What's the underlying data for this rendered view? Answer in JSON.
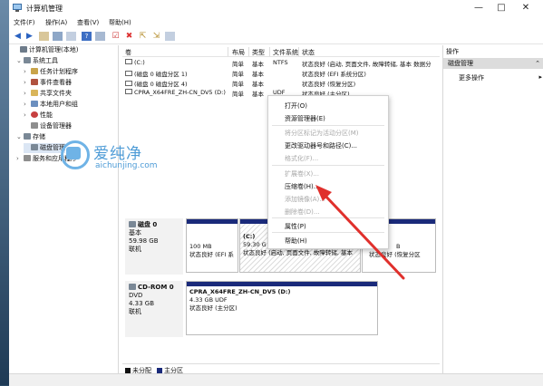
{
  "window": {
    "title": "计算机管理",
    "minimize": "—",
    "maximize": "□",
    "close": "✕"
  },
  "menu": [
    "文件(F)",
    "操作(A)",
    "查看(V)",
    "帮助(H)"
  ],
  "tree": [
    {
      "label": "计算机管理(本地)",
      "exp": "",
      "color": "#6d7b8a"
    },
    {
      "label": "系统工具",
      "exp": "⌄",
      "color": "#7a8896"
    },
    {
      "label": "任务计划程序",
      "exp": "›",
      "color": "#c9a44a"
    },
    {
      "label": "事件查看器",
      "exp": "›",
      "color": "#b0523f"
    },
    {
      "label": "共享文件夹",
      "exp": "›",
      "color": "#d9b55a"
    },
    {
      "label": "本地用户和组",
      "exp": "›",
      "color": "#6b8fbf"
    },
    {
      "label": "性能",
      "exp": "›",
      "color": "#c74040"
    },
    {
      "label": "设备管理器",
      "exp": "",
      "color": "#8e8e8e"
    },
    {
      "label": "存储",
      "exp": "⌄",
      "color": "#7a8896"
    },
    {
      "label": "磁盘管理",
      "exp": "",
      "color": "#7a8896"
    },
    {
      "label": "服务和应用程序",
      "exp": "›",
      "color": "#8e8e8e"
    }
  ],
  "volume_list": {
    "headers": [
      "卷",
      "布局",
      "类型",
      "文件系统",
      "状态"
    ],
    "rows": [
      {
        "name": "(C:)",
        "layout": "简单",
        "type": "基本",
        "fs": "NTFS",
        "status": "状态良好 (启动, 页面文件, 故障转储, 基本 数据分"
      },
      {
        "name": "(磁盘 0 磁盘分区 1)",
        "layout": "简单",
        "type": "基本",
        "fs": "",
        "status": "状态良好 (EFI 系统分区)"
      },
      {
        "name": "(磁盘 0 磁盘分区 4)",
        "layout": "简单",
        "type": "基本",
        "fs": "",
        "status": "状态良好 (恢复分区)"
      },
      {
        "name": "CPRA_X64FRE_ZH-CN_DV5 (D:)",
        "layout": "简单",
        "type": "基本",
        "fs": "UDF",
        "status": "状态良好 (主分区)"
      }
    ]
  },
  "context_menu": {
    "items": [
      {
        "label": "打开(O)",
        "disabled": false
      },
      {
        "label": "资源管理器(E)",
        "disabled": false
      },
      {
        "label": "将分区标记为活动分区(M)",
        "disabled": true
      },
      {
        "label": "更改驱动器号和路径(C)...",
        "disabled": false
      },
      {
        "label": "格式化(F)...",
        "disabled": true
      },
      {
        "label": "扩展卷(X)...",
        "disabled": true
      },
      {
        "label": "压缩卷(H)...",
        "disabled": false
      },
      {
        "label": "添加镜像(A)...",
        "disabled": true
      },
      {
        "label": "删除卷(D)...",
        "disabled": true
      },
      {
        "label": "属性(P)",
        "disabled": false
      },
      {
        "label": "帮助(H)",
        "disabled": false
      }
    ]
  },
  "actions": {
    "header": "操作",
    "selected": "磁盘管理",
    "more": "更多操作"
  },
  "disks": {
    "disk0": {
      "name": "磁盘 0",
      "type": "基本",
      "size": "59.98 GB",
      "state": "联机",
      "parts": [
        {
          "size": "100 MB",
          "status": "状态良好 (EFI 系"
        },
        {
          "title": "(C:)",
          "size": "59.30 G",
          "status": "状态良好 (启动, 页面文件, 故障转储, 基本"
        },
        {
          "size": "",
          "status": ""
        },
        {
          "size": "B",
          "status": "状态良好 (恢复分区"
        }
      ]
    },
    "cdrom0": {
      "name": "CD-ROM 0",
      "type": "DVD",
      "size": "4.33 GB",
      "state": "联机",
      "part": {
        "title": "CPRA_X64FRE_ZH-CN_DV5 (D:)",
        "size": "4.33 GB UDF",
        "status": "状态良好 (主分区)"
      }
    }
  },
  "legend": {
    "unallocated": "未分配",
    "primary": "主分区"
  },
  "watermark": {
    "cn": "爱纯净",
    "en": "aichunjing.com"
  },
  "colors": {
    "partition_bar": "#1a2a7a",
    "arrow": "#e0302c",
    "watermark": "#4d9bd6"
  }
}
